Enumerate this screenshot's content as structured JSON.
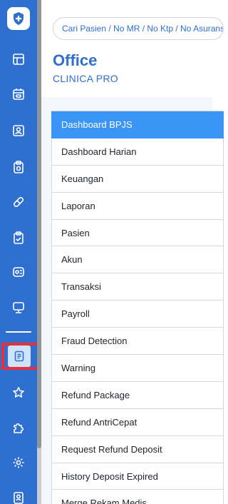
{
  "search": {
    "placeholder": "Cari Pasien / No MR / No Ktp / No Asuransi"
  },
  "header": {
    "title": "Office",
    "subtitle": "CLINICA PRO"
  },
  "sidebar": {
    "icons": [
      "layout-icon",
      "calendar-icon",
      "user-card-icon",
      "clipboard-icon",
      "pill-icon",
      "checklist-icon",
      "id-card-icon",
      "monitor-icon",
      "document-icon",
      "star-icon",
      "puzzle-icon",
      "gear-icon",
      "contact-icon"
    ]
  },
  "menu": {
    "items": [
      {
        "label": "Dashboard BPJS",
        "active": true
      },
      {
        "label": "Dashboard Harian"
      },
      {
        "label": "Keuangan"
      },
      {
        "label": "Laporan"
      },
      {
        "label": "Pasien"
      },
      {
        "label": "Akun"
      },
      {
        "label": "Transaksi"
      },
      {
        "label": "Payroll"
      },
      {
        "label": "Fraud Detection"
      },
      {
        "label": "Warning"
      },
      {
        "label": "Refund Package"
      },
      {
        "label": "Refund AntriCepat"
      },
      {
        "label": "Request Refund Deposit"
      },
      {
        "label": "History Deposit Expired"
      },
      {
        "label": "Merge Rekam Medis"
      }
    ]
  },
  "colors": {
    "sidebar": "#2f6fd0",
    "active_item": "#3b95f7",
    "highlight": "#e8303a",
    "brand_text": "#2f6fd0"
  }
}
